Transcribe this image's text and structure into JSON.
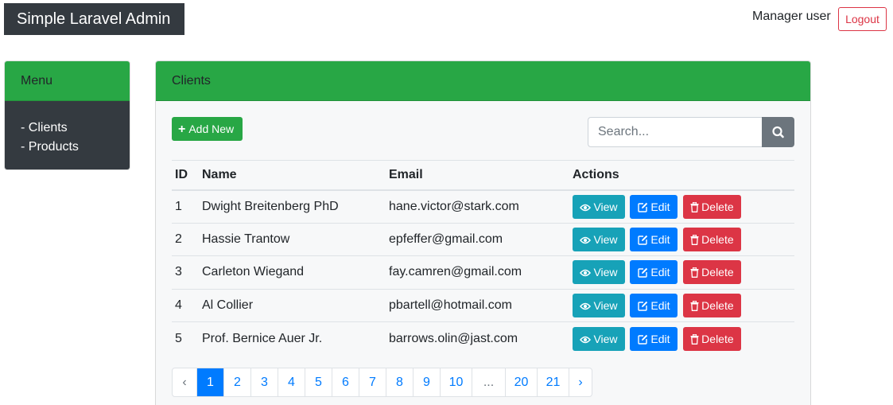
{
  "header": {
    "brand": "Simple Laravel Admin",
    "user": "Manager user",
    "logout_label": "Logout"
  },
  "menu": {
    "title": "Menu",
    "items": [
      {
        "label": "- Clients"
      },
      {
        "label": "- Products"
      }
    ]
  },
  "clients": {
    "title": "Clients",
    "add_label": "Add New",
    "search_placeholder": "Search...",
    "columns": [
      "ID",
      "Name",
      "Email",
      "Actions"
    ],
    "action_labels": {
      "view": "View",
      "edit": "Edit",
      "delete": "Delete"
    },
    "rows": [
      {
        "id": "1",
        "name": "Dwight Breitenberg PhD",
        "email": "hane.victor@stark.com"
      },
      {
        "id": "2",
        "name": "Hassie Trantow",
        "email": "epfeffer@gmail.com"
      },
      {
        "id": "3",
        "name": "Carleton Wiegand",
        "email": "fay.camren@gmail.com"
      },
      {
        "id": "4",
        "name": "Al Collier",
        "email": "pbartell@hotmail.com"
      },
      {
        "id": "5",
        "name": "Prof. Bernice Auer Jr.",
        "email": "barrows.olin@jast.com"
      }
    ]
  },
  "pagination": {
    "prev": "‹",
    "next": "›",
    "pages": [
      "1",
      "2",
      "3",
      "4",
      "5",
      "6",
      "7",
      "8",
      "9",
      "10",
      "...",
      "20",
      "21"
    ],
    "active": "1"
  },
  "colors": {
    "brand_bg": "#343a40",
    "header_green": "#28a745",
    "view": "#17a2b8",
    "edit": "#007bff",
    "delete": "#dc3545",
    "search_btn": "#6c757d"
  }
}
